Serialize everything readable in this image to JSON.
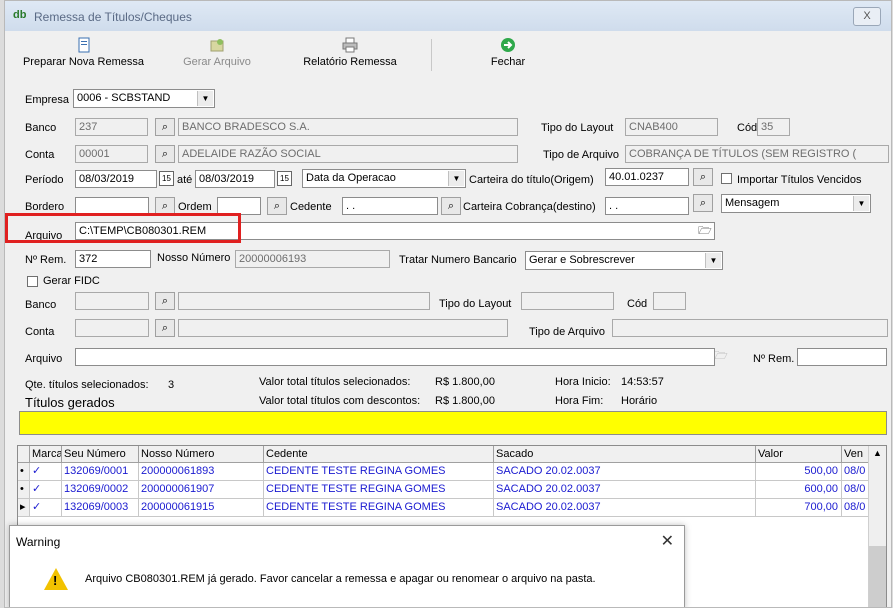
{
  "window": {
    "title": "Remessa de Títulos/Cheques",
    "app_icon": "db",
    "close_label": "X"
  },
  "toolbar": {
    "preparar": "Preparar Nova Remessa",
    "gerar": "Gerar Arquivo",
    "relatorio": "Relatório Remessa",
    "fechar": "Fechar"
  },
  "form": {
    "empresa_label": "Empresa",
    "empresa_value": "0006 - SCBSTAND",
    "banco_label": "Banco",
    "banco_code": "237",
    "banco_name": "BANCO BRADESCO S.A.",
    "tipo_layout_label": "Tipo do Layout",
    "tipo_layout_value": "CNAB400",
    "cod_label": "Cód",
    "cod_value": "35",
    "conta_label": "Conta",
    "conta_code": "00001",
    "conta_name": "ADELAIDE RAZÃO SOCIAL",
    "tipo_arquivo_label": "Tipo de Arquivo",
    "tipo_arquivo_value": "COBRANÇA DE TÍTULOS (SEM REGISTRO (",
    "periodo_label": "Período",
    "periodo_de": "08/03/2019",
    "ate_label": "até",
    "periodo_ate": "08/03/2019",
    "data_tipo": "Data da Operacao",
    "carteira_origem_label": "Carteira do título(Origem)",
    "carteira_origem_value": "40.01.0237",
    "importar_label": "Importar Títulos Vencidos",
    "bordero_label": "Bordero",
    "ordem_label": "Ordem",
    "cedente_label": "Cedente",
    "cedente_value": ". .",
    "carteira_destino_label": "Carteira Cobrança(destino)",
    "carteira_destino_value": ". .",
    "mensagem_value": "Mensagem",
    "arquivo_label": "Arquivo",
    "arquivo_value": "C:\\TEMP\\CB080301.REM",
    "nrem_label": "Nº Rem.",
    "nrem_value": "372",
    "nosso_numero_label": "Nosso Número",
    "nosso_numero_value": "20000006193",
    "tratar_label": "Tratar Numero Bancario",
    "tratar_value": "Gerar e Sobrescrever",
    "gerar_fidc_label": "Gerar FIDC",
    "banco2_label": "Banco",
    "tipo_layout2_label": "Tipo do Layout",
    "cod2_label": "Cód",
    "conta2_label": "Conta",
    "tipo_arquivo2_label": "Tipo de Arquivo",
    "arquivo2_label": "Arquivo",
    "nrem2_label": "Nº Rem."
  },
  "summary": {
    "qte_label": "Qte. títulos selecionados:",
    "qte_value": "3",
    "titulos_gerados": "Títulos gerados",
    "valor_sel_label": "Valor total títulos selecionados:",
    "valor_sel_value": "R$ 1.800,00",
    "valor_desc_label": "Valor total títulos com descontos:",
    "valor_desc_value": "R$ 1.800,00",
    "hora_inicio_label": "Hora Inicio:",
    "hora_inicio_value": "14:53:57",
    "hora_fim_label": "Hora Fim:",
    "hora_fim_value": "Horário"
  },
  "grid": {
    "headers": [
      "Marca",
      "Seu Número",
      "Nosso Número",
      "Cedente",
      "Sacado",
      "Valor",
      "Ven"
    ],
    "rows": [
      {
        "ind": "•",
        "marca": "✓",
        "seu": "132069/0001",
        "nosso": "200000061893",
        "cedente": "CEDENTE TESTE REGINA GOMES",
        "sacado": "SACADO 20.02.0037",
        "valor": "500,00",
        "ven": "08/0"
      },
      {
        "ind": "•",
        "marca": "✓",
        "seu": "132069/0002",
        "nosso": "200000061907",
        "cedente": "CEDENTE TESTE REGINA GOMES",
        "sacado": "SACADO 20.02.0037",
        "valor": "600,00",
        "ven": "08/0"
      },
      {
        "ind": "▸",
        "marca": "✓",
        "seu": "132069/0003",
        "nosso": "200000061915",
        "cedente": "CEDENTE TESTE REGINA GOMES",
        "sacado": "SACADO 20.02.0037",
        "valor": "700,00",
        "ven": "08/0"
      }
    ]
  },
  "dialog": {
    "title": "Warning",
    "close": "✕",
    "message": "Arquivo CB080301.REM já gerado. Favor cancelar a remessa e apagar ou renomear o arquivo na pasta.",
    "icon_glyph": "!"
  },
  "colors": {
    "highlight": "#ffff00",
    "error_outline": "#e02020",
    "row_text": "#1a1ad0"
  },
  "icons": [
    "new-document-icon",
    "generate-file-icon",
    "printer-icon",
    "exit-icon",
    "search-icon",
    "calendar-icon",
    "folder-open-icon",
    "warning-icon"
  ]
}
